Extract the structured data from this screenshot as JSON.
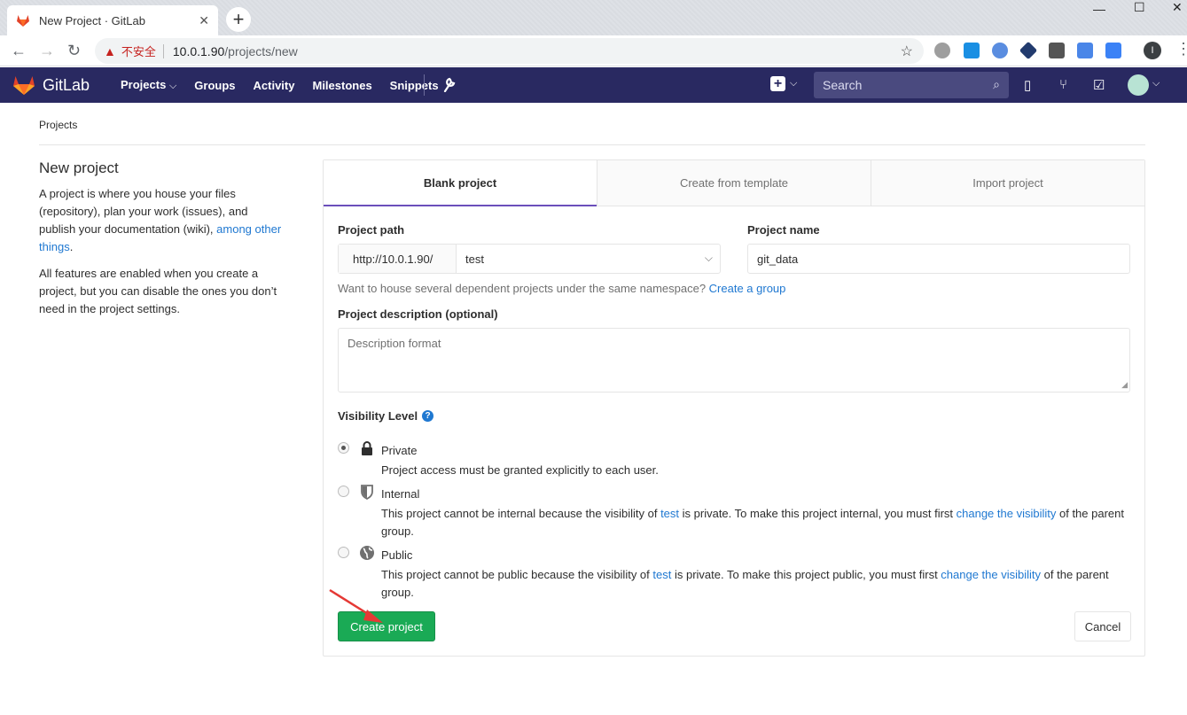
{
  "browser": {
    "tab_title": "New Project · GitLab",
    "tab_close": "✕",
    "new_tab": "+",
    "insecure_label": "不安全",
    "url_host": "10.0.1.90",
    "url_path": "/projects/new",
    "profile_initial": "I",
    "win_min": "—",
    "win_max": "☐",
    "win_close": "✕"
  },
  "navbar": {
    "brand": "GitLab",
    "items": [
      "Projects",
      "Groups",
      "Activity",
      "Milestones",
      "Snippets"
    ],
    "search_placeholder": "Search",
    "colors": {
      "bg": "#292961",
      "accent": "#6b4fbb"
    }
  },
  "breadcrumb": "Projects",
  "sidebar": {
    "title": "New project",
    "p1_text": "A project is where you house your files (repository), plan your work (issues), and publish your documentation (wiki), ",
    "p1_link": "among other things",
    "p1_end": ".",
    "p2": "All features are enabled when you create a project, but you can disable the ones you don’t need in the project settings."
  },
  "tabs": [
    "Blank project",
    "Create from template",
    "Import project"
  ],
  "form": {
    "path_label": "Project path",
    "path_prefix": "http://10.0.1.90/",
    "namespace": "test",
    "name_label": "Project name",
    "name_value": "git_data",
    "hint_text": "Want to house several dependent projects under the same namespace? ",
    "hint_link": "Create a group",
    "desc_label": "Project description (optional)",
    "desc_placeholder": "Description format",
    "visibility_label": "Visibility Level",
    "options": [
      {
        "name": "Private",
        "desc": "Project access must be granted explicitly to each user."
      },
      {
        "name": "Internal",
        "desc_a": "This project cannot be internal because the visibility of ",
        "desc_link1": "test",
        "desc_b": " is private. To make this project internal, you must first ",
        "desc_link2": "change the visibility",
        "desc_c": " of the parent group."
      },
      {
        "name": "Public",
        "desc_a": "This project cannot be public because the visibility of ",
        "desc_link1": "test",
        "desc_b": " is private. To make this project public, you must first ",
        "desc_link2": "change the visibility",
        "desc_c": " of the parent group."
      }
    ],
    "create_label": "Create project",
    "cancel_label": "Cancel",
    "colors": {
      "create": "#1aaa55",
      "link": "#1f78d1"
    }
  }
}
